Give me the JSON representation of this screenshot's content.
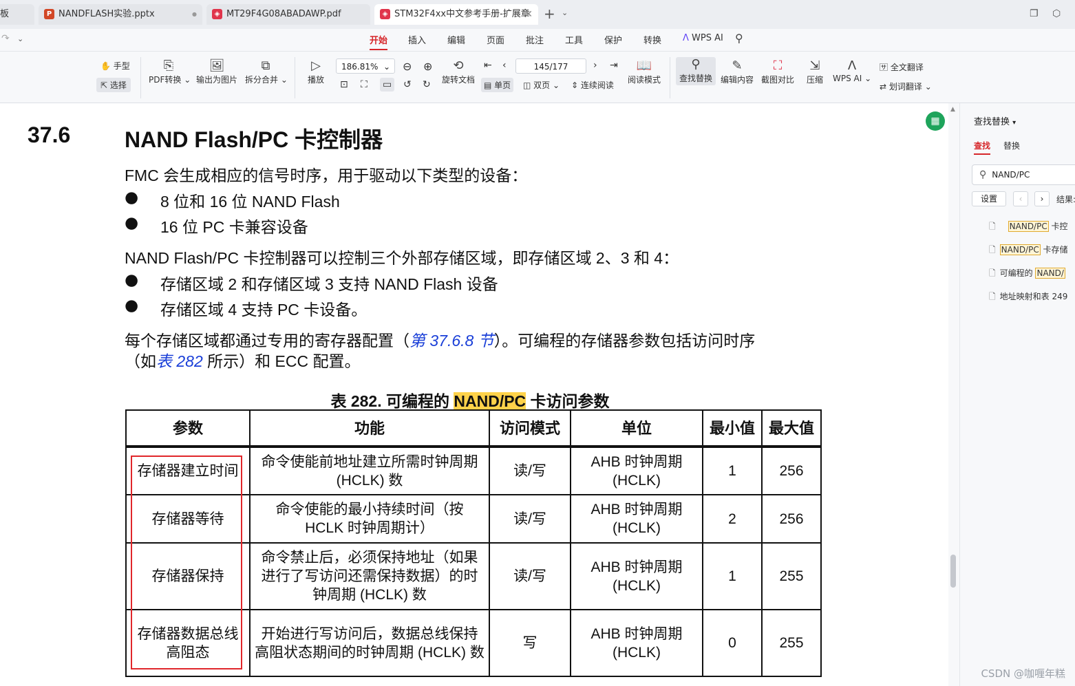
{
  "tabs": [
    {
      "label": "板",
      "icon": "",
      "active": false
    },
    {
      "label": "NANDFLASH实验.pptx",
      "icon": "P",
      "active": false,
      "dot": "●"
    },
    {
      "label": "MT29F4G08ABADAWP.pdf",
      "icon": "pdf-icon",
      "active": false
    },
    {
      "label": "STM32F4xx中文参考手册-扩展章",
      "icon": "pdf-icon",
      "active": true,
      "close": "✕"
    }
  ],
  "tab_controls": {
    "new_tab": "+",
    "dropdown": "⌄"
  },
  "menus": [
    "开始",
    "插入",
    "编辑",
    "页面",
    "批注",
    "工具",
    "保护",
    "转换",
    "WPS AI"
  ],
  "active_menu": "开始",
  "toolbar": {
    "hand_tool": "手型",
    "select_tool": "选择",
    "pdf_convert": "PDF转换",
    "export_image": "输出为图片",
    "split_merge": "拆分合并",
    "play": "播放",
    "zoom": "186.81%",
    "rotate_doc": "旋转文档",
    "page_indicator": "145/177",
    "single_page": "单页",
    "double_page": "双页",
    "continuous": "连续阅读",
    "reading_mode": "阅读模式",
    "find_replace": "查找替换",
    "edit_content": "编辑内容",
    "screenshot_compare": "截图对比",
    "compress": "压缩",
    "wps_ai": "WPS AI",
    "full_translate": "全文翻译",
    "word_translate": "划词翻译"
  },
  "document": {
    "section_number": "37.6",
    "section_title": "NAND Flash/PC 卡控制器",
    "intro": "FMC 会生成相应的信号时序，用于驱动以下类型的设备：",
    "bullets1": [
      "8 位和 16 位 NAND Flash",
      "16 位 PC 卡兼容设备"
    ],
    "para2": "NAND Flash/PC 卡控制器可以控制三个外部存储区域，即存储区域 2、3 和 4：",
    "bullets2": [
      "存储区域 2 和存储区域 3 支持 NAND Flash 设备",
      "存储区域 4 支持 PC 卡设备。"
    ],
    "para3_a": "每个存储区域都通过专用的寄存器配置（",
    "para3_link": "第 37.6.8 节",
    "para3_b": "）。可编程的存储器参数包括访问时序",
    "para4_a": "（如",
    "para4_link": "表 282",
    "para4_b": " 所示）和 ECC 配置。",
    "caption_a": "表 282. 可编程的 ",
    "caption_hl": "NAND/PC",
    "caption_b": " 卡访问参数",
    "table": {
      "headers": [
        "参数",
        "功能",
        "访问模式",
        "单位",
        "最小值",
        "最大值"
      ],
      "rows": [
        [
          "存储器建立时间",
          "命令使能前地址建立所需时钟周期 (HCLK) 数",
          "读/写",
          "AHB 时钟周期 (HCLK)",
          "1",
          "256"
        ],
        [
          "存储器等待",
          "命令使能的最小持续时间（按 HCLK 时钟周期计）",
          "读/写",
          "AHB 时钟周期 (HCLK)",
          "2",
          "256"
        ],
        [
          "存储器保持",
          "命令禁止后，必须保持地址（如果进行了写访问还需保持数据）的时钟周期 (HCLK) 数",
          "读/写",
          "AHB 时钟周期 (HCLK)",
          "1",
          "255"
        ],
        [
          "存储器数据总线高阻态",
          "开始进行写访问后，数据总线保持高阻状态期间的时钟周期 (HCLK) 数",
          "写",
          "AHB 时钟周期 (HCLK)",
          "0",
          "255"
        ]
      ]
    }
  },
  "panel": {
    "title": "查找替换",
    "tab_find": "查找",
    "tab_replace": "替换",
    "search_value": "NAND/PC",
    "settings": "设置",
    "results_label": "结果:",
    "results": [
      {
        "pre": "",
        "hl": "NAND/PC",
        "post": " 卡控"
      },
      {
        "pre": "",
        "hl": "NAND/PC",
        "post": " 卡存储"
      },
      {
        "pre": "可编程的 ",
        "hl": "NAND/",
        "post": ""
      },
      {
        "pre": "地址映射和表 249",
        "hl": "",
        "post": ""
      }
    ]
  },
  "watermark": "CSDN @咖喱年糕"
}
